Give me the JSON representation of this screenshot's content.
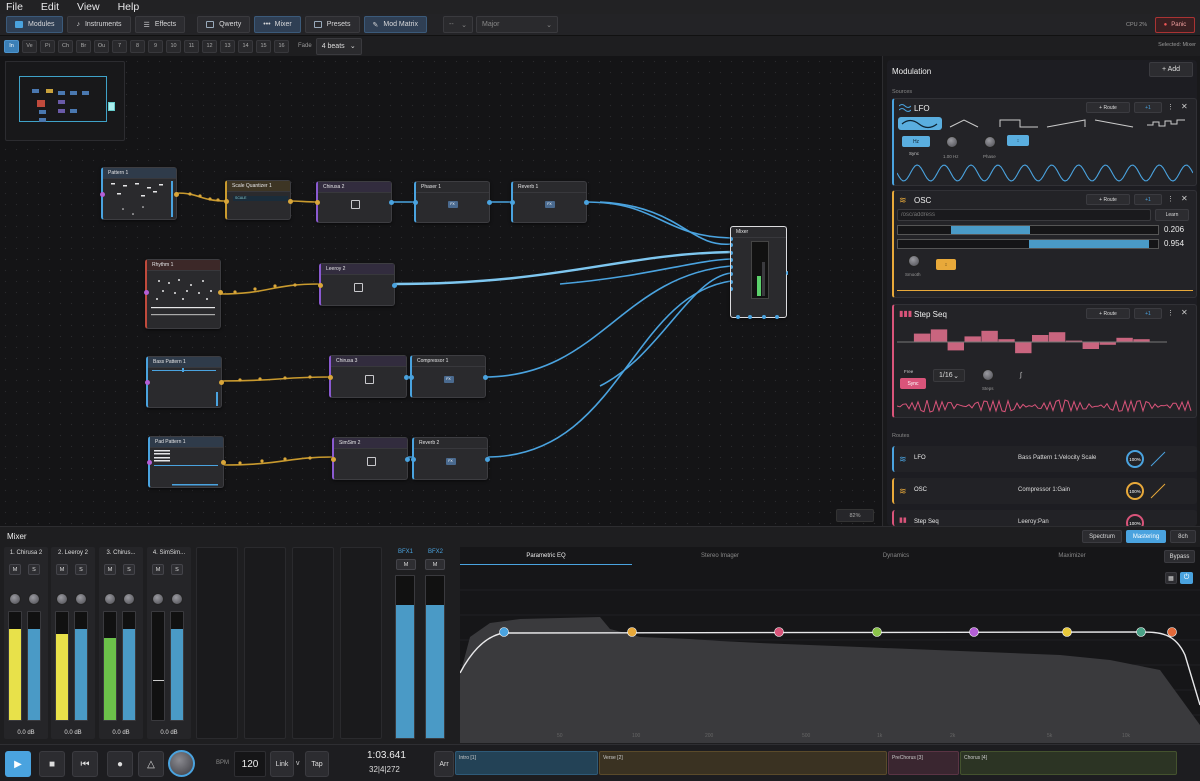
{
  "menu": [
    "File",
    "Edit",
    "View",
    "Help"
  ],
  "toolbar": {
    "buttons": [
      "Modules",
      "Instruments",
      "Effects",
      "Qwerty",
      "Mixer",
      "Presets",
      "Mod Matrix"
    ],
    "key_select": "--",
    "scale_select": "Major",
    "cpu": "CPU 2%",
    "panic": "Panic"
  },
  "channels": {
    "items": [
      "In",
      "Ve",
      "Pi",
      "Ch",
      "Br",
      "Ou",
      "7",
      "8",
      "9",
      "10",
      "11",
      "12",
      "13",
      "14",
      "15",
      "16"
    ],
    "fade_label": "Fade",
    "fade_value": "4 beats",
    "selected": "Selected: Mixer"
  },
  "nodes": {
    "pattern1": "Pattern 1",
    "scale_quantizer": "Scale Quantizer 1",
    "scale_label": "SCALE",
    "chirusa2": "Chirusa 2",
    "phaser1": "Phaser 1",
    "reverb1": "Reverb 1",
    "mixer": "Mixer",
    "rhythm1": "Rhythm 1",
    "leeroy2": "Leeroy 2",
    "bass_pattern1": "Bass Pattern 1",
    "chirusa3": "Chirusa 3",
    "compressor1": "Compressor 1",
    "pad_pattern1": "Pad Pattern 1",
    "simsim2": "SimSim 2",
    "reverb2": "Reverb 2",
    "fx": "FX",
    "zoom": "82%"
  },
  "modulation": {
    "title": "Modulation",
    "add": "+ Add",
    "sources_label": "Sources",
    "route_btn": "+ Route",
    "plus1": "+1",
    "lfo": {
      "name": "LFO",
      "hz": "Hz",
      "sync": "Sync",
      "rate": "1.00 Hz",
      "phase": "Phase"
    },
    "osc": {
      "name": "OSC",
      "address_placeholder": "/osc/address",
      "learn": "Learn",
      "val1": "0.206",
      "val2": "0.954",
      "smooth": "Smooth"
    },
    "stepseq": {
      "name": "Step Seq",
      "free": "Free",
      "sync": "Sync",
      "div": "1/16",
      "steps": "Steps"
    },
    "routes_label": "Routes",
    "routes": [
      {
        "source": "LFO",
        "target": "Bass Pattern 1:Velocity Scale",
        "amount": "100%",
        "color": "#4aa3df"
      },
      {
        "source": "OSC",
        "target": "Compressor 1:Gain",
        "amount": "100%",
        "color": "#e8a93a"
      },
      {
        "source": "Step Seq",
        "target": "Leeroy:Pan",
        "amount": "100%",
        "color": "#d9547a"
      }
    ]
  },
  "mixer": {
    "title": "Mixer",
    "tabs_right": [
      "Spectrum",
      "Mastering",
      "8ch"
    ],
    "strips": [
      {
        "name": "1. Chirusa 2",
        "db": "0.0 dB"
      },
      {
        "name": "2. Leeroy 2",
        "db": "0.0 dB"
      },
      {
        "name": "3. Chirus...",
        "db": "0.0 dB"
      },
      {
        "name": "4. SimSim...",
        "db": "0.0 dB"
      }
    ],
    "bfx": [
      "BFX1",
      "BFX2"
    ],
    "m": "M",
    "s": "S",
    "eq_tabs": [
      "Parametric EQ",
      "Stereo Imager",
      "Dynamics",
      "Maximizer"
    ],
    "bypass": "Bypass",
    "eq_ticks": [
      "50",
      "100",
      "200",
      "500",
      "1k",
      "2k",
      "5k",
      "10k"
    ]
  },
  "transport": {
    "bpm_label": "BPM",
    "bpm": "120",
    "link": "Link",
    "v": "v",
    "tap": "Tap",
    "time": "1:03.641",
    "position": "32|4|272",
    "arr": "Arr",
    "sections": [
      "Intro [1]",
      "Verse [2]",
      "PreChorus [3]",
      "Chorus [4]"
    ]
  }
}
